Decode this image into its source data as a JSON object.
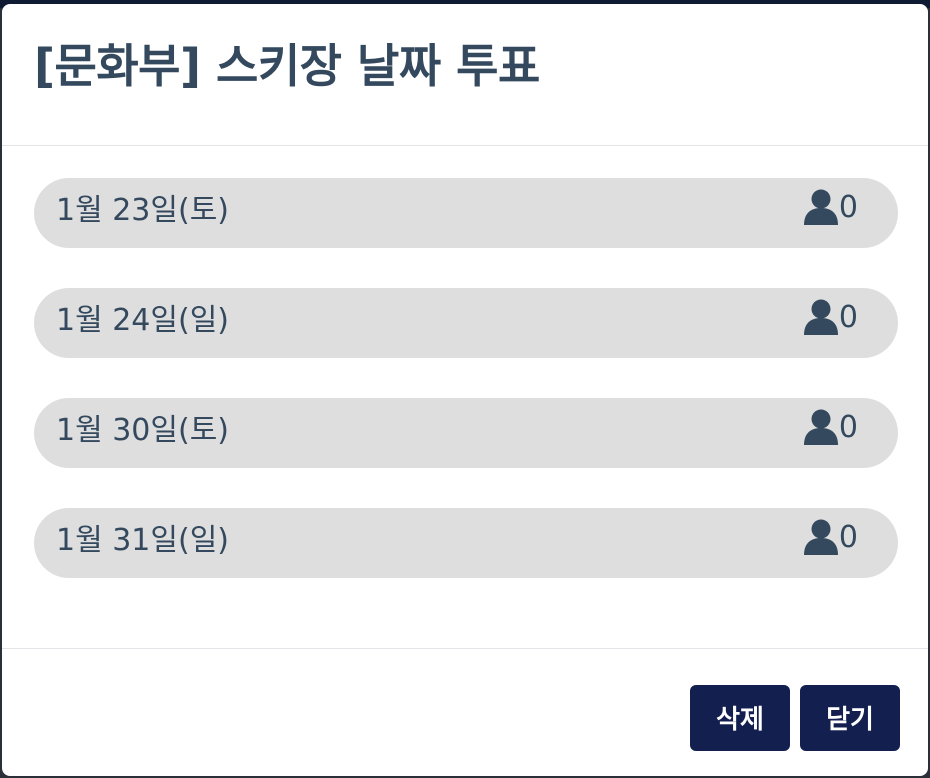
{
  "modal": {
    "title": "[문화부] 스키장 날짜 투표"
  },
  "options": [
    {
      "label": "1월 23일(토)",
      "count": "0"
    },
    {
      "label": "1월 24일(일)",
      "count": "0"
    },
    {
      "label": "1월 30일(토)",
      "count": "0"
    },
    {
      "label": "1월 31일(일)",
      "count": "0"
    }
  ],
  "footer": {
    "delete_label": "삭제",
    "close_label": "닫기"
  },
  "colors": {
    "primary": "#13204f",
    "text": "#34495e",
    "option_bg": "#dedede"
  },
  "icons": {
    "vote_count": "user-icon"
  }
}
